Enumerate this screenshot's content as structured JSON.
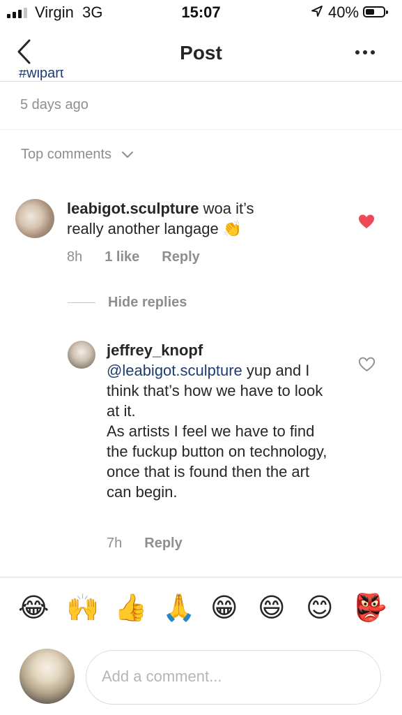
{
  "status_bar": {
    "carrier": "Virgin",
    "network": "3G",
    "time": "15:07",
    "battery": "40%",
    "battery_level": 0.4,
    "signal_bars_on": 3,
    "signal_bars_total": 4
  },
  "nav": {
    "title": "Post"
  },
  "post": {
    "hashtag_peek": "#wipart",
    "posted_ago": "5 days ago"
  },
  "comments_header": {
    "label": "Top comments"
  },
  "comments": [
    {
      "username": "leabigot.sculpture",
      "text": " woa it’s really another langage ",
      "emoji": "👏",
      "time": "8h",
      "likes": "1 like",
      "reply": "Reply",
      "liked": true
    }
  ],
  "hide_replies": "Hide replies",
  "reply": {
    "username": "jeffrey_knopf",
    "mention": "@leabigot.sculpture",
    "line1_rest": " yup and I think that’s how we have to look at it.",
    "line2": "As artists I feel we have to find the fuckup button on technology, once that is found then the art can begin.",
    "time": "7h",
    "reply": "Reply",
    "liked": false
  },
  "emoji_bar": [
    "😂",
    "🙌",
    "👍",
    "🙏",
    "😁",
    "😄",
    "😊",
    "👺"
  ],
  "comment_input": {
    "placeholder": "Add a comment..."
  },
  "colors": {
    "heart_liked": "#ed4956",
    "mention": "#1e3c72",
    "secondary_text": "#8e8e8e"
  }
}
